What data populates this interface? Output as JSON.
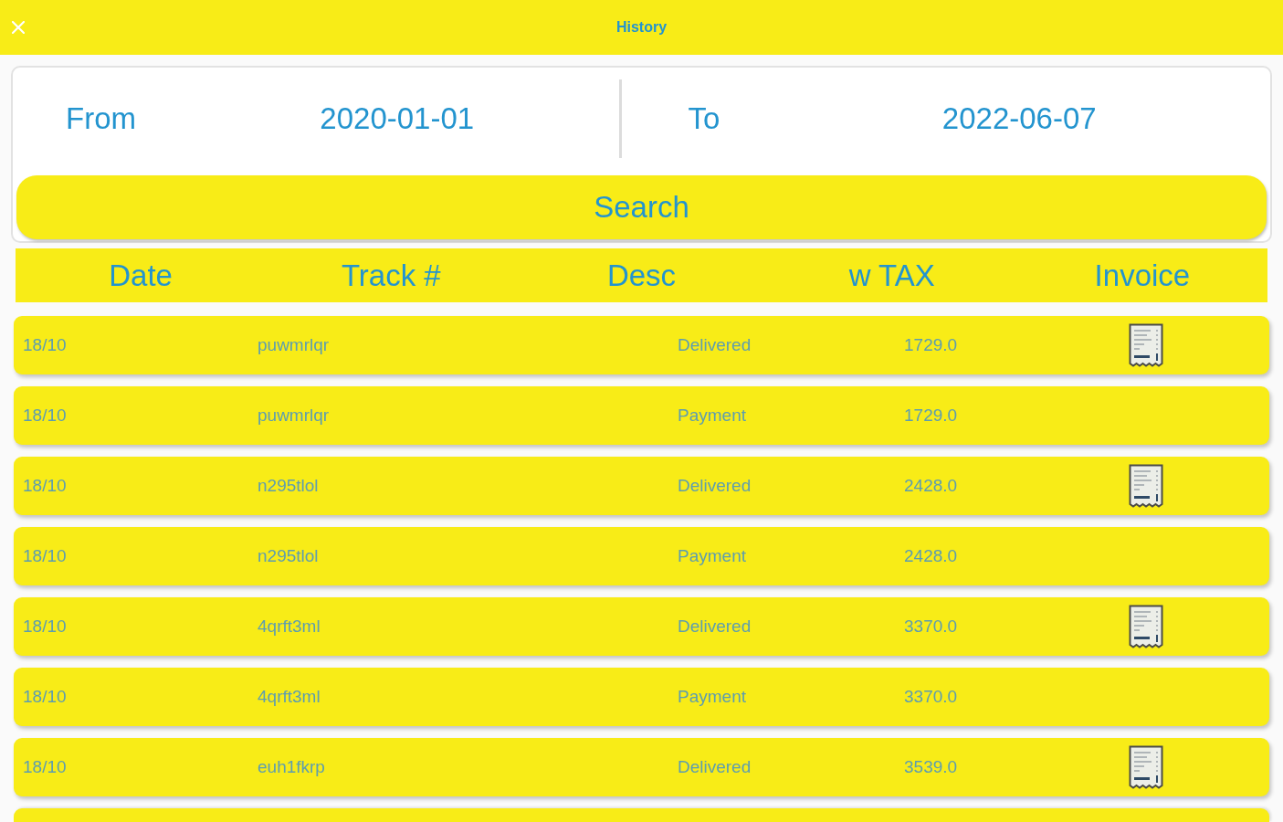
{
  "window": {
    "title": "History"
  },
  "date_range": {
    "from_label": "From",
    "from_value": "2020-01-01",
    "to_label": "To",
    "to_value": "2022-06-07",
    "search_button": "Search"
  },
  "table": {
    "columns": [
      "Date",
      "Track #",
      "Desc",
      "w TAX",
      "Invoice"
    ],
    "rows": [
      {
        "date": "18/10",
        "track": "puwmrlqr",
        "desc": "Delivered",
        "w_tax": "1729.0",
        "invoice": true
      },
      {
        "date": "18/10",
        "track": "puwmrlqr",
        "desc": "Payment",
        "w_tax": "1729.0",
        "invoice": false
      },
      {
        "date": "18/10",
        "track": "n295tlol",
        "desc": "Delivered",
        "w_tax": "2428.0",
        "invoice": true
      },
      {
        "date": "18/10",
        "track": "n295tlol",
        "desc": "Payment",
        "w_tax": "2428.0",
        "invoice": false
      },
      {
        "date": "18/10",
        "track": "4qrft3ml",
        "desc": "Delivered",
        "w_tax": "3370.0",
        "invoice": true
      },
      {
        "date": "18/10",
        "track": "4qrft3ml",
        "desc": "Payment",
        "w_tax": "3370.0",
        "invoice": false
      },
      {
        "date": "18/10",
        "track": "euh1fkrp",
        "desc": "Delivered",
        "w_tax": "3539.0",
        "invoice": true
      }
    ],
    "more_rows_below": true
  }
}
